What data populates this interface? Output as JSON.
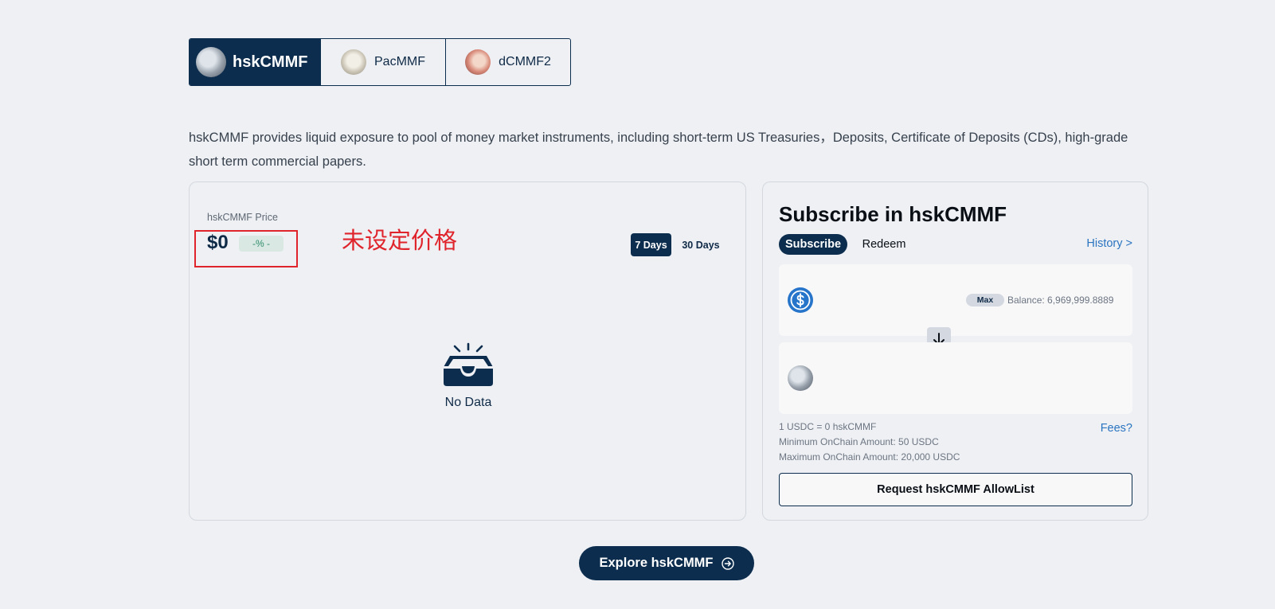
{
  "token_tabs": [
    {
      "label": "hskCMMF",
      "active": true
    },
    {
      "label": "PacMMF",
      "active": false
    },
    {
      "label": "dCMMF2",
      "active": false
    }
  ],
  "description": "hskCMMF provides liquid exposure to pool of money market instruments, including short-term US Treasuries，Deposits, Certificate of Deposits (CDs), high-grade short term commercial papers.",
  "price_panel": {
    "label": "hskCMMF Price",
    "value": "$0",
    "change": "-% -",
    "annotation": "未设定价格",
    "ranges": [
      "7 Days",
      "30 Days"
    ],
    "selected_range": "7 Days",
    "empty_text": "No Data"
  },
  "subscribe": {
    "title": "Subscribe in hskCMMF",
    "tabs": [
      "Subscribe",
      "Redeem"
    ],
    "active_tab": "Subscribe",
    "history_link": "History >",
    "max_label": "Max",
    "balance": "Balance: 6,969,999.8889",
    "rate": "1 USDC = 0 hskCMMF",
    "fees_link": "Fees?",
    "min_amount": "Minimum OnChain Amount: 50 USDC",
    "max_amount": "Maximum OnChain Amount: 20,000 USDC",
    "allowlist_button": "Request hskCMMF AllowList"
  },
  "explore_button": "Explore hskCMMF",
  "colors": {
    "navy": "#0c2d4e",
    "link": "#2a74c0",
    "annotation_red": "#e0242c",
    "positive_green": "#2e8c6a"
  },
  "icons": [
    "usdc-icon",
    "inbox-empty-icon",
    "arrow-down-icon",
    "arrow-right-circle-icon"
  ]
}
